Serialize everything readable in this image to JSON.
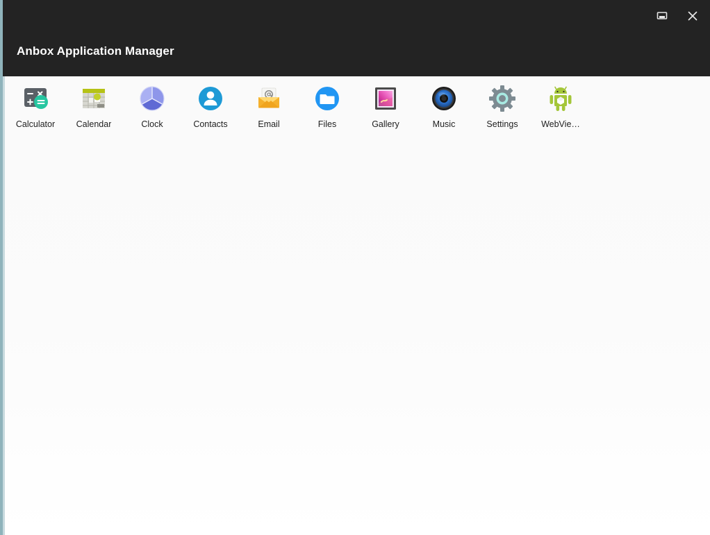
{
  "window": {
    "title": "Anbox Application Manager",
    "controls": [
      {
        "name": "restore-window-button",
        "icon": "window-restore-icon",
        "label": ""
      },
      {
        "name": "close-window-button",
        "icon": "close-icon",
        "label": ""
      }
    ]
  },
  "colors": {
    "titlebar_background": "#232323",
    "titlebar_text": "#fdfdfd",
    "content_background": "#fafafa",
    "window_edge": "#8fb3bb",
    "label_text": "#212121",
    "calculator_body": "#5a6066",
    "calculator_accent": "#26c6a0",
    "calendar_top_bar": "#b5c216",
    "calendar_body": "#d3d3cd",
    "clock_body": "#7f86e0",
    "contacts_blue": "#1e9ad6",
    "email_amber": "#f7b733",
    "files_blue": "#2196f3",
    "gallery_frame": "#4a4a4a",
    "gallery_image": "#e040a0",
    "music_blue": "#2a6fc9",
    "settings_gray": "#7d8b92",
    "settings_inner": "#a8eae2",
    "android_green": "#a4c639"
  },
  "apps": [
    {
      "id": "calculator",
      "label": "Calculator",
      "icon": "calculator-icon"
    },
    {
      "id": "calendar",
      "label": "Calendar",
      "icon": "calendar-icon"
    },
    {
      "id": "clock",
      "label": "Clock",
      "icon": "clock-icon"
    },
    {
      "id": "contacts",
      "label": "Contacts",
      "icon": "contacts-icon"
    },
    {
      "id": "email",
      "label": "Email",
      "icon": "email-icon"
    },
    {
      "id": "files",
      "label": "Files",
      "icon": "files-icon"
    },
    {
      "id": "gallery",
      "label": "Gallery",
      "icon": "gallery-icon"
    },
    {
      "id": "music",
      "label": "Music",
      "icon": "music-icon"
    },
    {
      "id": "settings",
      "label": "Settings",
      "icon": "settings-icon"
    },
    {
      "id": "webview",
      "label": "WebVie…",
      "icon": "android-webview-icon"
    }
  ]
}
